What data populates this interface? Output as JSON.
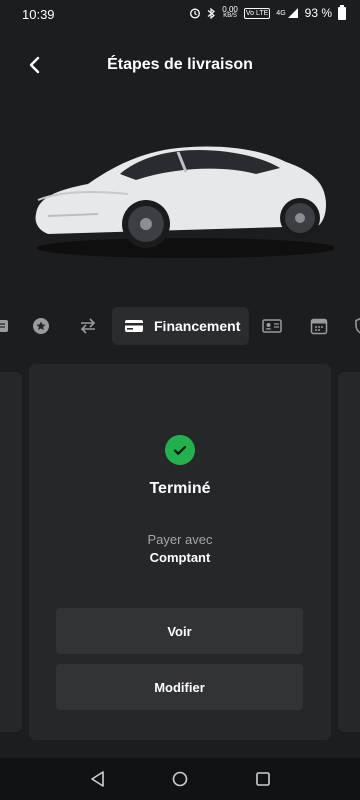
{
  "status_bar": {
    "time": "10:39",
    "speed_value": "0,00",
    "speed_unit": "KB/S",
    "volte": "Vo LTE",
    "network": "4G",
    "battery": "93 %"
  },
  "header": {
    "title": "Étapes de livraison"
  },
  "steps": {
    "items": [
      {
        "icon": "document-icon",
        "active": false
      },
      {
        "icon": "star-badge-icon",
        "active": false
      },
      {
        "icon": "swap-arrows-icon",
        "active": false
      },
      {
        "icon": "credit-card-icon",
        "active": true,
        "label": "Financement"
      },
      {
        "icon": "id-card-icon",
        "active": false
      },
      {
        "icon": "calendar-icon",
        "active": false
      },
      {
        "icon": "shield-icon",
        "active": false
      }
    ]
  },
  "card": {
    "status": "Terminé",
    "pay_label": "Payer avec",
    "pay_value": "Comptant",
    "view_button": "Voir",
    "edit_button": "Modifier"
  },
  "colors": {
    "background": "#1c1d1f",
    "card": "#262729",
    "success": "#22b14c"
  }
}
